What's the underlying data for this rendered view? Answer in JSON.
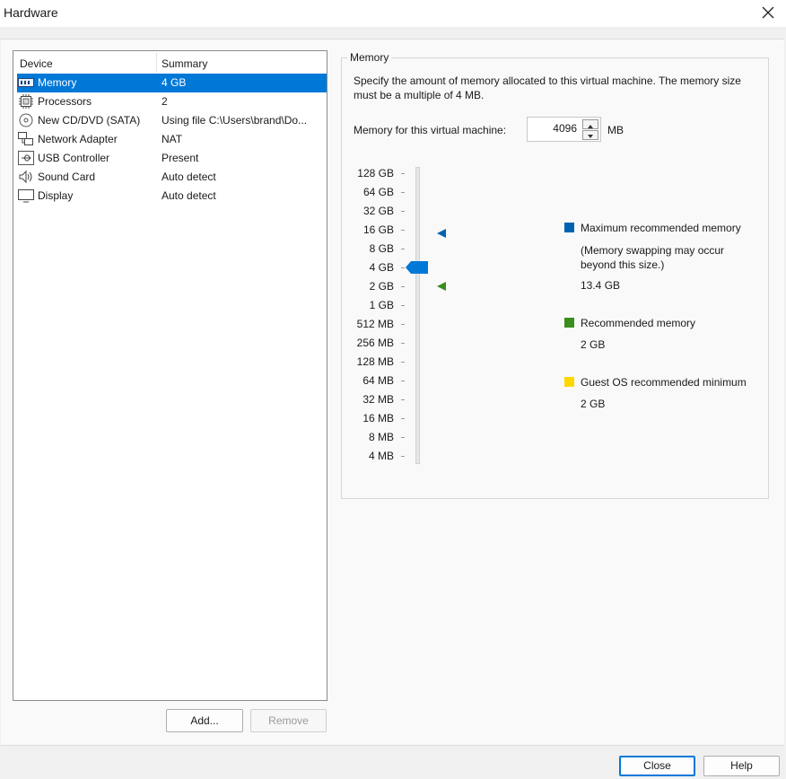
{
  "window": {
    "title": "Hardware"
  },
  "device_list": {
    "headers": {
      "device": "Device",
      "summary": "Summary"
    },
    "rows": [
      {
        "name": "Memory",
        "summary": "4 GB",
        "icon": "memory-icon",
        "selected": true
      },
      {
        "name": "Processors",
        "summary": "2",
        "icon": "processor-icon"
      },
      {
        "name": "New CD/DVD (SATA)",
        "summary": "Using file C:\\Users\\brand\\Do...",
        "icon": "cd-dvd-icon"
      },
      {
        "name": "Network Adapter",
        "summary": "NAT",
        "icon": "network-adapter-icon"
      },
      {
        "name": "USB Controller",
        "summary": "Present",
        "icon": "usb-icon"
      },
      {
        "name": "Sound Card",
        "summary": "Auto detect",
        "icon": "speaker-icon"
      },
      {
        "name": "Display",
        "summary": "Auto detect",
        "icon": "monitor-icon"
      }
    ]
  },
  "buttons": {
    "add": "Add...",
    "remove": "Remove",
    "close": "Close",
    "help": "Help"
  },
  "memory": {
    "group_title": "Memory",
    "description": "Specify the amount of memory allocated to this virtual machine. The memory size must be a multiple of 4 MB.",
    "field_label": "Memory for this virtual machine:",
    "value": "4096",
    "unit": "MB",
    "scale": [
      "128 GB",
      "64 GB",
      "32 GB",
      "16 GB",
      "8 GB",
      "4 GB",
      "2 GB",
      "1 GB",
      "512 MB",
      "256 MB",
      "128 MB",
      "64 MB",
      "32 MB",
      "16 MB",
      "8 MB",
      "4 MB"
    ],
    "slider_value": "4 GB",
    "legend": {
      "max_label": "Maximum recommended memory",
      "max_note": "(Memory swapping may occur beyond this size.)",
      "max_value": "13.4 GB",
      "rec_label": "Recommended memory",
      "rec_value": "2 GB",
      "guest_label": "Guest OS recommended minimum",
      "guest_value": "2 GB"
    },
    "colors": {
      "max": "#0063b1",
      "recommended": "#3a8e1c",
      "guest_min": "#ffd800",
      "thumb": "#0078d7"
    }
  }
}
